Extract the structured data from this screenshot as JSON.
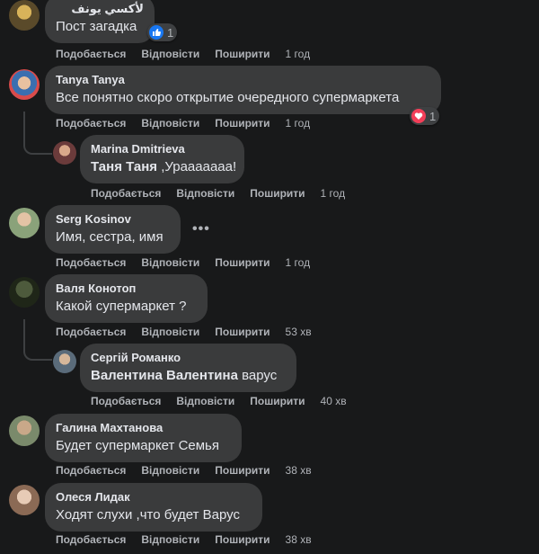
{
  "actions": {
    "like": "Подобається",
    "reply": "Відповісти",
    "share": "Поширити"
  },
  "more_label": "•••",
  "comments": [
    {
      "author": "لأكسي يونف",
      "text": "Пост загадка",
      "time": "1 год",
      "reaction": "like",
      "reaction_count": "1"
    },
    {
      "author": "Tanya Tanya",
      "text": "Все понятно скоро открытие очередного супермаркета",
      "time": "1 год",
      "reaction": "love",
      "reaction_count": "1"
    },
    {
      "author": "Marina Dmitrieva",
      "mention": "Таня Таня",
      "text": " ,Урааааааа!",
      "time": "1 год"
    },
    {
      "author": "Serg Kosinov",
      "text": "Имя, сестра, имя",
      "time": "1 год"
    },
    {
      "author": "Валя Конотоп",
      "text": "Какой супермаркет ?",
      "time": "53 хв"
    },
    {
      "author": "Сергій Романко",
      "mention": "Валентина Валентина",
      "text": " варус",
      "time": "40 хв"
    },
    {
      "author": "Галина Махтанова",
      "text": "Будет супермаркет Семья",
      "time": "38 хв"
    },
    {
      "author": "Олеся Лидак",
      "text": "Ходят слухи ,что будет Варус",
      "time": "38 хв"
    }
  ],
  "colors": {
    "background": "#18191a",
    "bubble": "#3a3b3c",
    "text": "#e4e6eb",
    "secondary": "#b0b3b8",
    "like": "#1877f2",
    "love": "#f33e58"
  }
}
